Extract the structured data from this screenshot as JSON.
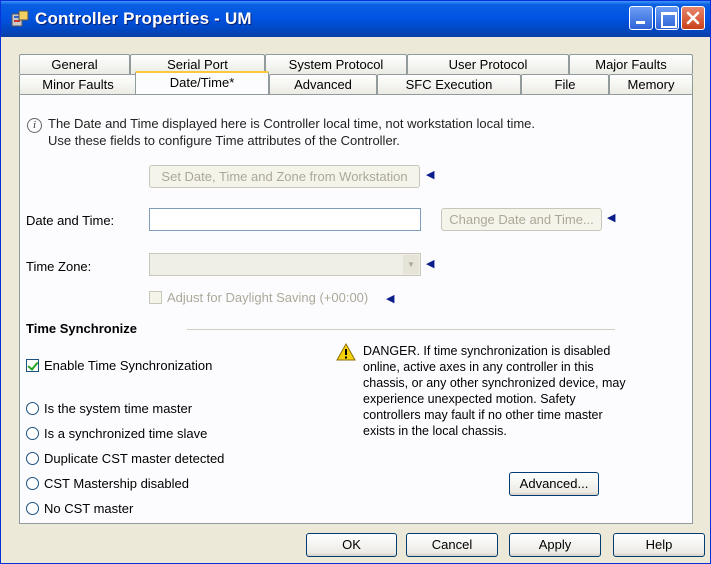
{
  "window": {
    "title": "Controller Properties - UM"
  },
  "tabs_row1": [
    "General",
    "Serial Port",
    "System Protocol",
    "User Protocol",
    "Major Faults"
  ],
  "tabs_row2": [
    "Minor Faults",
    "Date/Time*",
    "Advanced",
    "SFC Execution",
    "File",
    "Memory"
  ],
  "active_tab": "Date/Time*",
  "info": {
    "line1": "The Date and Time displayed here is Controller local time, not workstation local time.",
    "line2": "Use these fields to configure Time attributes of the Controller."
  },
  "set_from_workstation_label": "Set Date, Time and Zone from Workstation",
  "date_time": {
    "label": "Date and Time:",
    "value": "",
    "change_button": "Change Date and Time..."
  },
  "time_zone": {
    "label": "Time Zone:",
    "value": ""
  },
  "daylight_saving": {
    "label": "Adjust for Daylight Saving (+00:00)",
    "checked": false
  },
  "time_sync": {
    "title": "Time Synchronize",
    "enable_label": "Enable Time Synchronization",
    "enabled": true,
    "radios": [
      "Is the system time master",
      "Is a synchronized time slave",
      "Duplicate CST master detected",
      "CST Mastership disabled",
      "No CST master"
    ],
    "danger_text": "DANGER. If time synchronization is disabled online, active axes in any controller in this chassis, or any other synchronized device, may experience unexpected motion.  Safety controllers may fault if no other time master exists in the local chassis.",
    "advanced_button": "Advanced..."
  },
  "footer": {
    "ok": "OK",
    "cancel": "Cancel",
    "apply": "Apply",
    "help": "Help"
  }
}
